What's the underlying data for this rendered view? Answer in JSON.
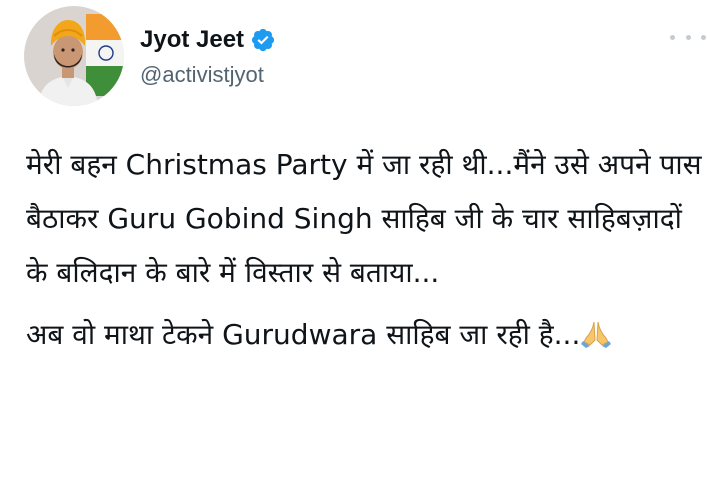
{
  "author": {
    "display_name": "Jyot Jeet",
    "handle": "@activistjyot",
    "verified": true
  },
  "tweet": {
    "paragraphs": [
      "मेरी बहन Christmas Party में जा रही थी...मैंने उसे अपने पास बैठाकर Guru Gobind Singh साहिब जी के चार साहिबज़ादों के बलिदान के बारे में विस्तार से बताया...",
      "अब वो माथा टेकने Gurudwara साहिब जा रही है..."
    ],
    "emoji": "folded-hands-emoji"
  },
  "icons": {
    "verified": "verified-badge-icon",
    "more": "more-options-icon"
  },
  "colors": {
    "text": "#0f1419",
    "secondary": "#536471",
    "verified": "#1d9bf0",
    "turban": "#f2a71b"
  }
}
